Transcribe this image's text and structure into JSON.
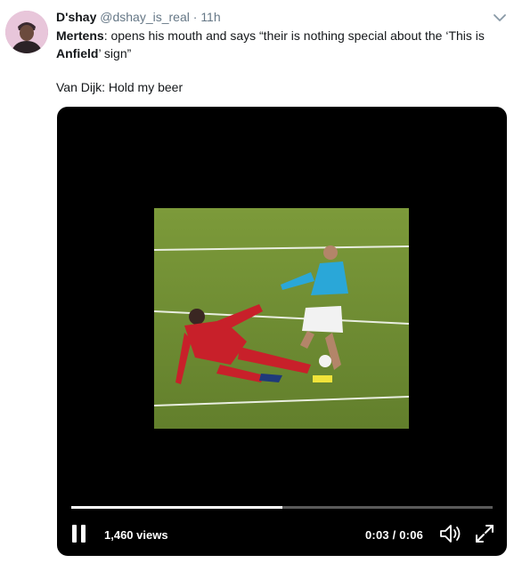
{
  "tweet": {
    "author": {
      "name": "D'shay",
      "handle": "@dshay_is_real",
      "separator": "·",
      "time": "11h"
    },
    "text": {
      "speaker1": "Mertens",
      "line1_rest": ": opens his mouth and says “their is nothing special about the ‘This is ",
      "emphasis": "Anfield",
      "line1_end": "’ sign”",
      "line2": "Van Dijk: Hold my beer"
    },
    "icons": {
      "more": "chevron-down-icon",
      "pause": "pause-icon",
      "volume": "volume-icon",
      "fullscreen": "fullscreen-icon"
    }
  },
  "video": {
    "views": "1,460 views",
    "timecode": "0:03 / 0:06",
    "progress": 0.5,
    "colors": {
      "background": "#000000",
      "progress_fill": "#ffffff",
      "progress_track": "#5a5a5a",
      "pitch": "#6f8d34",
      "player_red": "#c8202a",
      "player_blue": "#2aa7d8"
    }
  }
}
